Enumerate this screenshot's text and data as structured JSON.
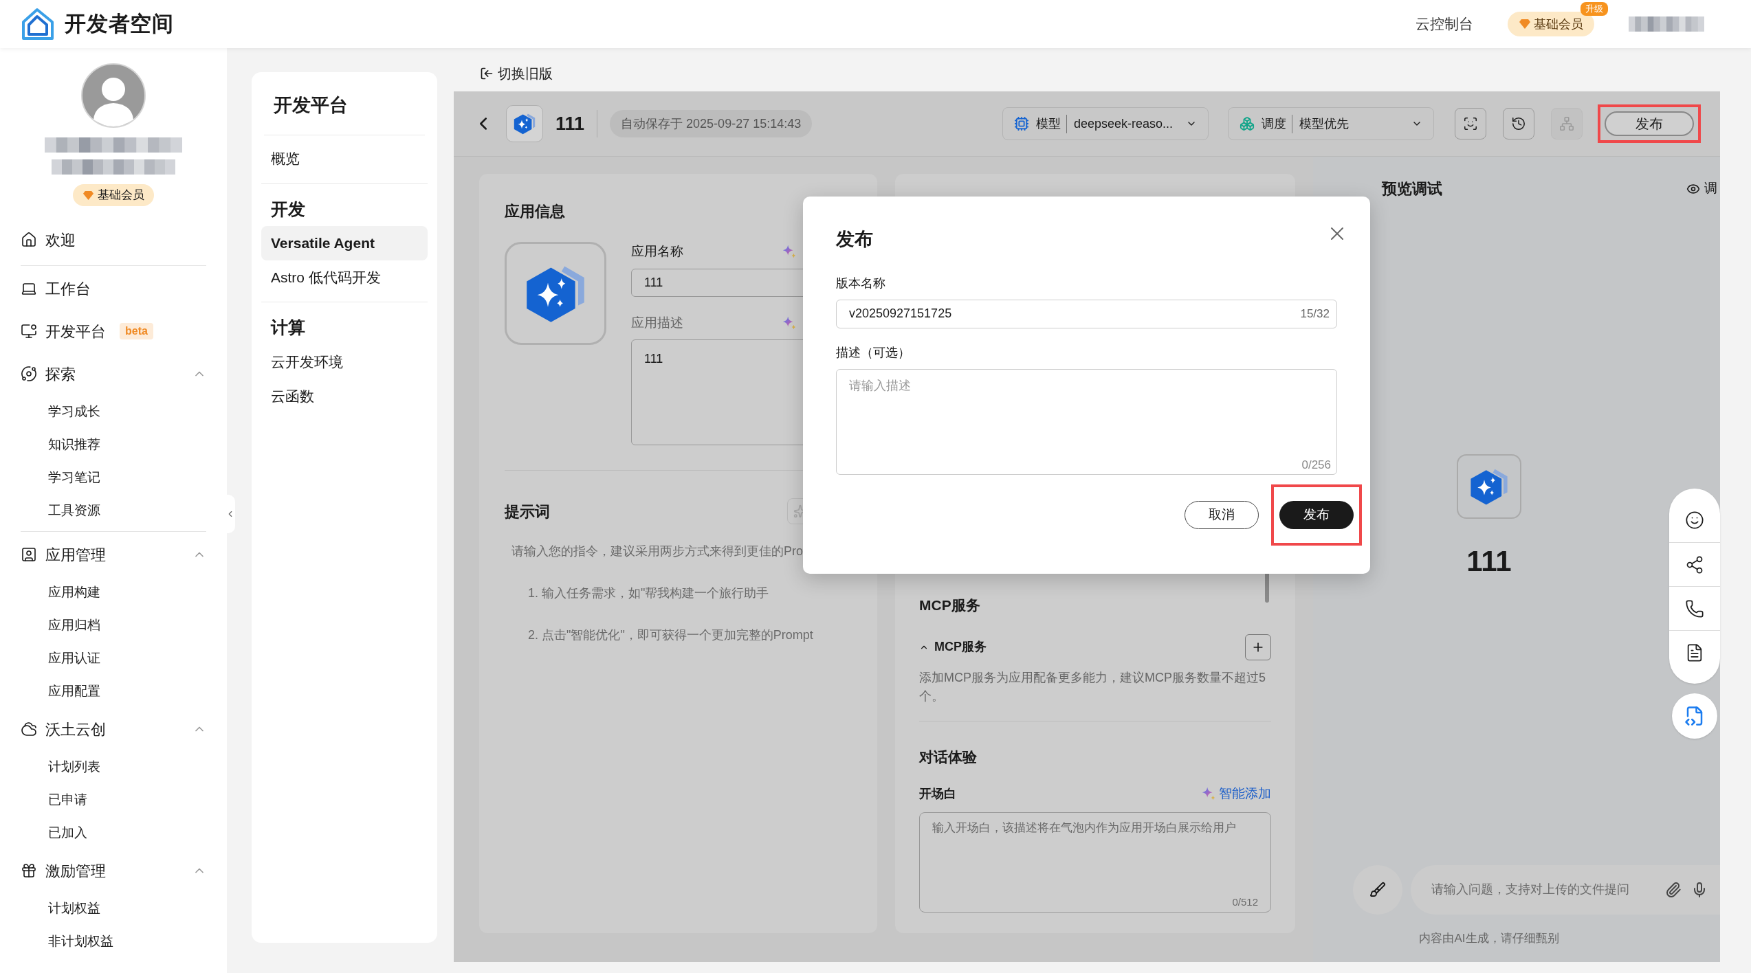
{
  "top_bar": {
    "brand": "开发者空间",
    "console_link": "云控制台",
    "membership": {
      "label": "基础会员",
      "badge": "升级"
    }
  },
  "sidebar": {
    "membership": "基础会员",
    "items": [
      {
        "kind": "link",
        "label": "欢迎"
      },
      {
        "kind": "link",
        "label": "工作台"
      },
      {
        "kind": "link",
        "label": "开发平台",
        "badge": "beta"
      },
      {
        "kind": "group",
        "label": "探索",
        "expanded": true,
        "children": [
          {
            "label": "学习成长"
          },
          {
            "label": "知识推荐"
          },
          {
            "label": "学习笔记"
          },
          {
            "label": "工具资源"
          }
        ]
      },
      {
        "kind": "group",
        "label": "应用管理",
        "expanded": true,
        "children": [
          {
            "label": "应用构建"
          },
          {
            "label": "应用归档"
          },
          {
            "label": "应用认证"
          },
          {
            "label": "应用配置"
          }
        ]
      },
      {
        "kind": "group",
        "label": "沃土云创",
        "expanded": true,
        "children": [
          {
            "label": "计划列表"
          },
          {
            "label": "已申请"
          },
          {
            "label": "已加入"
          }
        ]
      },
      {
        "kind": "group",
        "label": "激励管理",
        "expanded": true,
        "children": [
          {
            "label": "计划权益"
          },
          {
            "label": "非计划权益"
          }
        ]
      }
    ]
  },
  "nav_panel": {
    "title": "开发平台",
    "items": [
      {
        "label": "概览",
        "selected": false
      }
    ],
    "sections": [
      {
        "title": "开发",
        "items": [
          {
            "label": "Versatile Agent",
            "selected": true
          },
          {
            "label": "Astro 低代码开发",
            "selected": false
          }
        ]
      },
      {
        "title": "计算",
        "items": [
          {
            "label": "云开发环境",
            "selected": false
          },
          {
            "label": "云函数",
            "selected": false
          }
        ]
      }
    ]
  },
  "switch_link": "切换旧版",
  "header": {
    "app_name": "111",
    "autosave": "自动保存于 2025-09-27 15:14:43",
    "model": {
      "label": "模型",
      "value": "deepseek-reaso..."
    },
    "schedule": {
      "label": "调度",
      "value": "模型优先"
    },
    "tools": [
      {
        "disabled": false
      },
      {
        "disabled": false
      },
      {
        "disabled": true
      }
    ],
    "publish": {
      "label": "发布",
      "highlighted": true
    }
  },
  "app_info": {
    "title": "应用信息",
    "name_label": "应用名称",
    "name_value": "111",
    "desc_label": "应用描述",
    "desc_value": "111"
  },
  "prompt": {
    "title": "提示词",
    "hint": "请输入您的指令，建议采用两步方式来得到更佳的Pro",
    "steps": [
      "1. 输入任务需求，如\"帮我构建一个旅行助手",
      "2. 点击\"智能优化\"，即可获得一个更加完整的Prompt"
    ]
  },
  "mcp": {
    "title": "MCP服务",
    "group": {
      "label": "MCP服务",
      "expanded": true
    },
    "description": "添加MCP服务为应用配备更多能力，建议MCP服务数量不超过5个。"
  },
  "conversation": {
    "title": "对话体验",
    "opening": {
      "label": "开场白",
      "action": "智能添加",
      "placeholder": "输入开场白，该描述将在气泡内作为应用开场白展示给用户",
      "counter": "0/512"
    }
  },
  "preview": {
    "title": "预览调试",
    "debug_link": "调",
    "app_name": "111",
    "input_placeholder": "请输入问题，支持对上传的文件提问",
    "disclaimer": "内容由AI生成，请仔细甄别"
  },
  "dialog": {
    "title": "发布",
    "version_label": "版本名称",
    "version_value": "v20250927151725",
    "version_counter": "15/32",
    "desc_label": "描述（可选）",
    "desc_placeholder": "请输入描述",
    "desc_counter": "0/256",
    "buttons": [
      {
        "kind": "secondary",
        "label": "取消",
        "highlighted": false
      },
      {
        "kind": "primary",
        "label": "发布",
        "highlighted": true
      }
    ]
  }
}
